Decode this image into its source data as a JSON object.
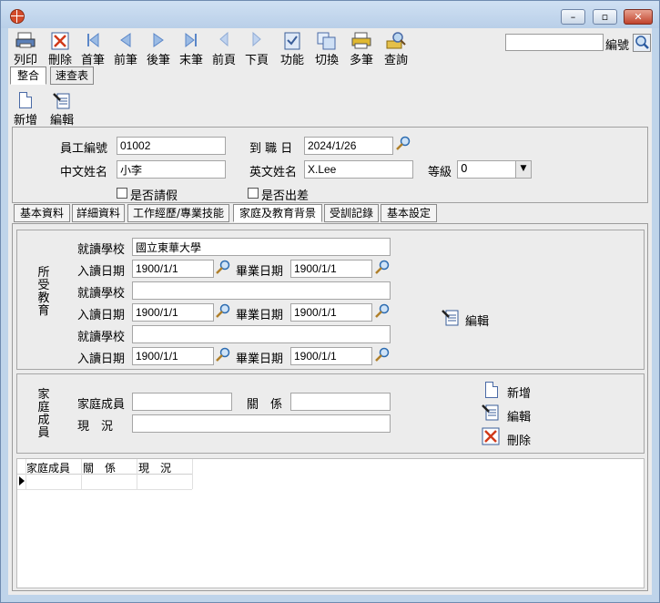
{
  "toolbar": {
    "print": "列印",
    "delete": "刪除",
    "first": "首筆",
    "prev": "前筆",
    "next": "後筆",
    "last": "末筆",
    "prev_page": "前頁",
    "next_page": "下頁",
    "function": "功能",
    "switch": "切換",
    "multi": "多筆",
    "query": "查詢"
  },
  "search": {
    "label": "編號",
    "value": ""
  },
  "view_tabs": {
    "integrated": "整合",
    "quick_table": "速查表"
  },
  "record_tools": {
    "add": "新增",
    "edit": "編輯"
  },
  "employee": {
    "id_label": "員工編號",
    "id_value": "01002",
    "join_label": "到 職 日",
    "join_value": "2024/1/26",
    "cname_label": "中文姓名",
    "cname_value": "小李",
    "ename_label": "英文姓名",
    "ename_value": "X.Lee",
    "grade_label": "等級",
    "grade_value": "0",
    "leave_label": "是否請假",
    "trip_label": "是否出差"
  },
  "tabs": [
    "基本資料",
    "詳細資料",
    "工作經歷/專業技能",
    "家庭及教育背景",
    "受訓記錄",
    "基本設定"
  ],
  "education": {
    "section_label": "所受教育",
    "school_label": "就讀學校",
    "enroll_label": "入讀日期",
    "grad_label": "畢業日期",
    "rows": [
      {
        "school": "國立東華大學",
        "enroll": "1900/1/1",
        "grad": "1900/1/1"
      },
      {
        "school": "",
        "enroll": "1900/1/1",
        "grad": "1900/1/1"
      },
      {
        "school": "",
        "enroll": "1900/1/1",
        "grad": "1900/1/1"
      }
    ],
    "edit_label": "編輯"
  },
  "family": {
    "section_label": "家庭成員",
    "member_label": "家庭成員",
    "relation_label": "關　係",
    "status_label": "現　況",
    "member_value": "",
    "relation_value": "",
    "status_value": "",
    "add_label": "新增",
    "edit_label": "編輯",
    "delete_label": "刪除"
  },
  "grid": {
    "columns": [
      "家庭成員",
      "關　係",
      "現　況"
    ]
  },
  "colors": {
    "accent": "#3a6fc4",
    "title_bar": "#c4d8ef"
  }
}
